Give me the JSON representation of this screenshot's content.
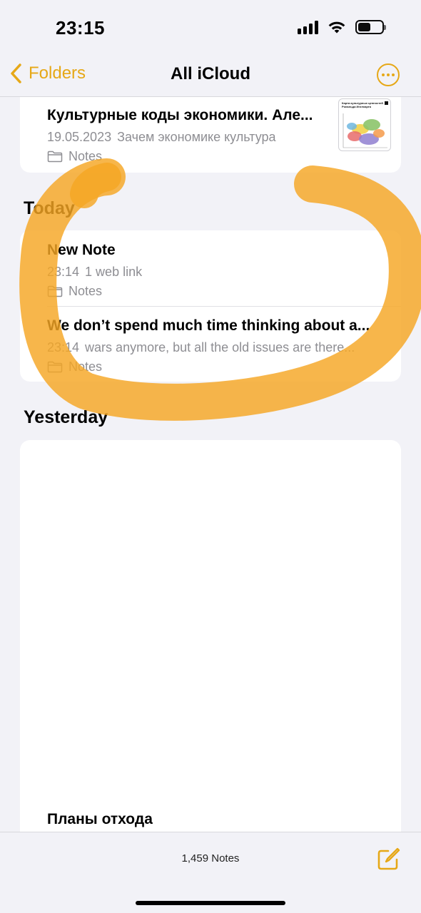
{
  "status_bar": {
    "time": "23:15"
  },
  "nav": {
    "back_label": "Folders",
    "title": "All iCloud"
  },
  "pinned_note": {
    "title": "Культурные коды экономики. Але...",
    "date": "19.05.2023",
    "preview": "Зачем экономике культура",
    "folder": "Notes",
    "thumbnail_caption": "Карта культурных ценностей Рональда Инглхарта"
  },
  "sections": {
    "today": "Today",
    "yesterday": "Yesterday"
  },
  "today_notes": [
    {
      "title": "New Note",
      "time": "23:14",
      "preview": "1 web link",
      "folder": "Notes"
    },
    {
      "title": "We don’t spend much time thinking about a...",
      "time": "23:14",
      "preview": "wars anymore, but all the old issues are there...",
      "folder": "Notes"
    }
  ],
  "yesterday_notes": [
    {
      "title": "Планы отхода"
    }
  ],
  "toolbar": {
    "count": "1,459 Notes"
  },
  "colors": {
    "accent": "#e6a817",
    "highlight": "#f5a623",
    "background": "#f2f2f7"
  },
  "icons": [
    "back-chevron-icon",
    "more-icon",
    "folder-icon",
    "compose-icon",
    "signal-icon",
    "wifi-icon",
    "battery-icon"
  ]
}
